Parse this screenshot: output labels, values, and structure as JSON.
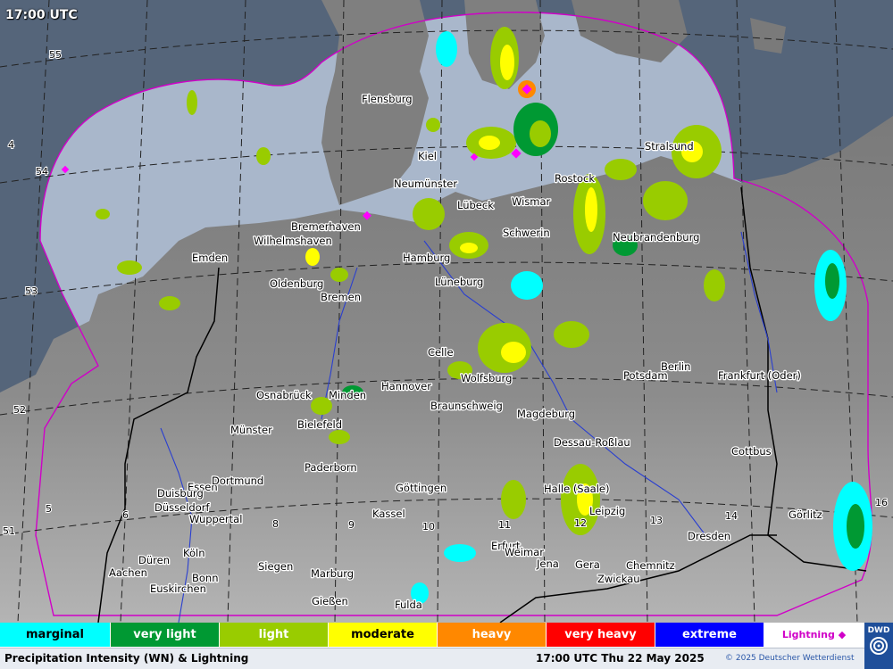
{
  "map": {
    "time_label": "17:00 UTC",
    "latitude_labels": [
      "55",
      "54",
      "53",
      "52",
      "51"
    ],
    "longitude_labels": [
      "4",
      "5",
      "6",
      "8",
      "9",
      "10",
      "11",
      "12",
      "13",
      "14",
      "16"
    ],
    "cities": [
      "Flensburg",
      "Kiel",
      "Neumünster",
      "Lübeck",
      "Wismar",
      "Rostock",
      "Stralsund",
      "Bremerhaven",
      "Wilhelmshaven",
      "Schwerin",
      "Neubrandenburg",
      "Emden",
      "Hamburg",
      "Oldenburg",
      "Bremen",
      "Lüneburg",
      "Celle",
      "Berlin",
      "Wolfsburg",
      "Potsdam",
      "Frankfurt (Oder)",
      "Osnabrück",
      "Minden",
      "Hannover",
      "Braunschweig",
      "Magdeburg",
      "Bielefeld",
      "Münster",
      "Dessau-Roßlau",
      "Cottbus",
      "Paderborn",
      "Essen",
      "Dortmund",
      "Duisburg",
      "Düsseldorf",
      "Wuppertal",
      "Göttingen",
      "Halle (Saale)",
      "Leipzig",
      "Kassel",
      "Görlitz",
      "Dresden",
      "Erfurt",
      "Weimar",
      "Jena",
      "Gera",
      "Chemnitz",
      "Düren",
      "Köln",
      "Siegen",
      "Aachen",
      "Bonn",
      "Euskirchen",
      "Marburg",
      "Zwickau",
      "Gießen",
      "Fulda"
    ],
    "colors": {
      "sea": "#aab8cc",
      "land": "#8a8a8a",
      "radar_range": "#d000c8",
      "lightning": "#ff00ff"
    }
  },
  "legend": {
    "items": [
      {
        "label": "marginal",
        "color": "#00ffff",
        "text_color": "#000000"
      },
      {
        "label": "very light",
        "color": "#009933",
        "text_color": "#ffffff"
      },
      {
        "label": "light",
        "color": "#99cc00",
        "text_color": "#ffffff"
      },
      {
        "label": "moderate",
        "color": "#ffff00",
        "text_color": "#000000"
      },
      {
        "label": "heavy",
        "color": "#ff8800",
        "text_color": "#ffffff"
      },
      {
        "label": "very heavy",
        "color": "#ff0000",
        "text_color": "#ffffff"
      },
      {
        "label": "extreme",
        "color": "#0000ff",
        "text_color": "#ffffff"
      }
    ],
    "lightning_label": "Lightning ◆"
  },
  "footer": {
    "title": "Precipitation Intensity (WN) & Lightning",
    "datetime": "17:00 UTC Thu 22 May 2025",
    "copyright": "© 2025 Deutscher Wetterdienst",
    "logo_text": "DWD"
  }
}
